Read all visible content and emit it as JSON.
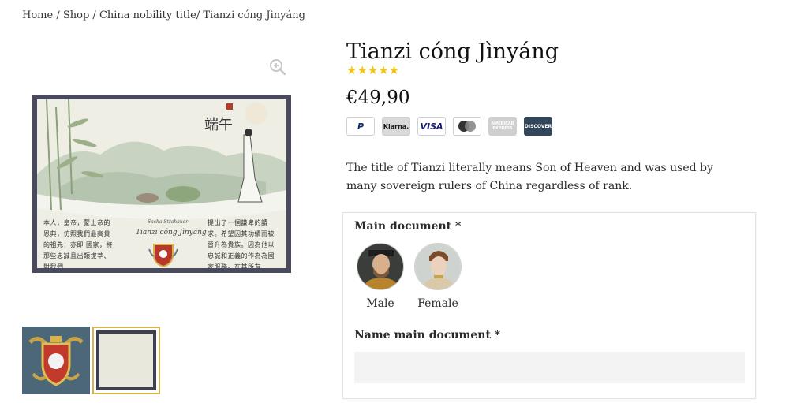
{
  "breadcrumb": {
    "home": "Home",
    "sep": " / ",
    "shop": "Shop",
    "category": "China nobility title",
    "current": "/ Tianzi cóng Jìnyáng"
  },
  "product": {
    "title": "Tianzi cóng Jìnyáng",
    "rating_stars": "★★★★★",
    "rating_value": 5,
    "price": "€49,90",
    "description": "The title of Tianzi literally means Son of Heaven and was used by many sovereign rulers of China regardless of rank."
  },
  "payments": [
    {
      "name": "PayPal",
      "label": "P"
    },
    {
      "name": "Klarna",
      "label": "Klarna."
    },
    {
      "name": "Visa",
      "label": "VISA"
    },
    {
      "name": "Mastercard",
      "label": ""
    },
    {
      "name": "American Express",
      "label": "AMERICAN EXPRESS"
    },
    {
      "name": "Discover",
      "label": "DISCOVER"
    }
  ],
  "document_preview": {
    "left_text": "本人，皇帝，蒙上帝的恩典，仿照我們最高貴的祖先，亦即 國家，將那些忠誠且出類拔萃、對我們",
    "right_text": "提出了一個謙卑的請求。希望因其功績而被晉升為貴族。因為他以忠誠和正義的作為為國家服務。在其所有",
    "signer": "Sacha Strahauer",
    "name": "Tianzi cóng Jìnyáng"
  },
  "options": {
    "main_document_label": "Main document *",
    "choices": [
      {
        "label": "Male"
      },
      {
        "label": "Female"
      }
    ],
    "name_label": "Name main document *",
    "name_value": "",
    "name_placeholder": ""
  },
  "colors": {
    "star": "#f0c419",
    "thumb_active_border": "#d7b54a",
    "input_bg": "#f3f3f3",
    "frame": "#4a4a5e"
  },
  "icons": [
    "zoom-in-icon"
  ]
}
